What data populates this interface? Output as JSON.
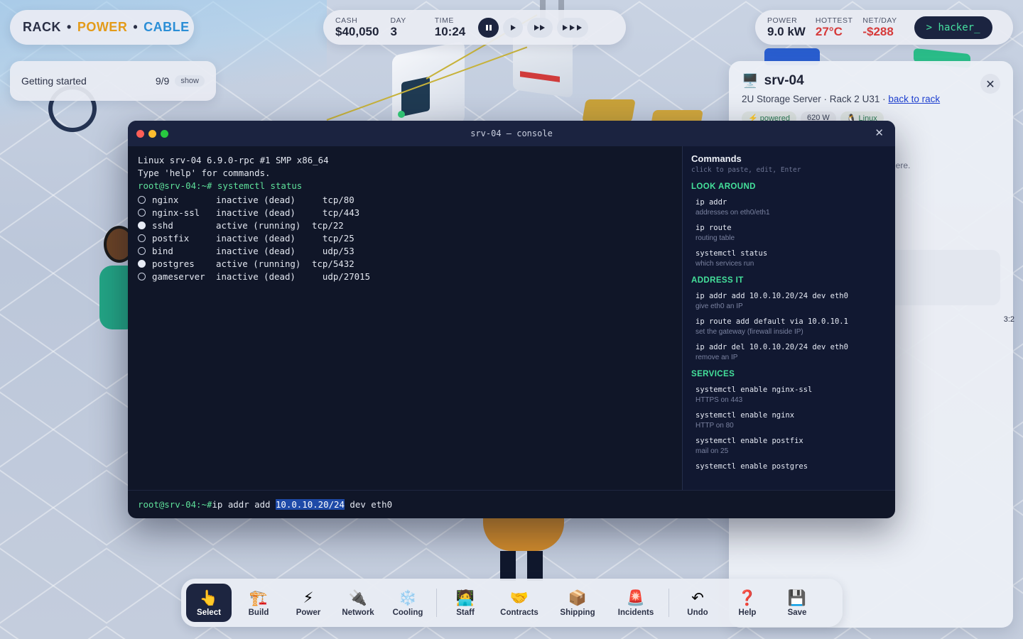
{
  "brand": {
    "rack": "RACK",
    "dot": "•",
    "power": "POWER",
    "cable": "CABLE"
  },
  "getting_started": {
    "title": "Getting started",
    "count": "9/9",
    "show_label": "show"
  },
  "hud": {
    "cash_label": "CASH",
    "cash": "$40,050",
    "day_label": "DAY",
    "day": "3",
    "time_label": "TIME",
    "time": "10:24",
    "power_label": "POWER",
    "power": "9.0 kW",
    "hottest_label": "HOTTEST",
    "hottest": "27°C",
    "net_label": "NET/DAY",
    "net": "-$288",
    "hacker_label": "> hacker_",
    "speed_icons": {
      "pause": "pause-icon",
      "play": "play-icon",
      "fast": "fast-forward-icon",
      "faster": "faster-forward-icon"
    },
    "colors": {
      "hot": "#d63a3a",
      "net": "#d63a3a"
    }
  },
  "inspector": {
    "icon": "🖥️",
    "title": "srv-04",
    "subtitle": "2U Storage Server · Rack 2 U31 · ",
    "back_link": "back to rack",
    "badges": [
      "⚡ powered",
      "620 W",
      "🐧 Linux"
    ],
    "partial_text": "nere.",
    "edge_text": "3:2"
  },
  "console": {
    "title": "srv-04 — console",
    "boot_line1": "Linux srv-04 6.9.0-rpc #1 SMP x86_64",
    "boot_line2": "Type 'help' for commands.",
    "prompt": "root@srv-04:~#",
    "last_command": " systemctl status",
    "services": [
      {
        "name": "nginx",
        "state": "inactive (dead)",
        "port": "  tcp/80",
        "active": false
      },
      {
        "name": "nginx-ssl",
        "state": "inactive (dead)",
        "port": "  tcp/443",
        "active": false
      },
      {
        "name": "sshd",
        "state": "active (running)",
        "port": "tcp/22",
        "active": true
      },
      {
        "name": "postfix",
        "state": "inactive (dead)",
        "port": "  tcp/25",
        "active": false
      },
      {
        "name": "bind",
        "state": "inactive (dead)",
        "port": "  udp/53",
        "active": false
      },
      {
        "name": "postgres",
        "state": "active (running)",
        "port": "tcp/5432",
        "active": true
      },
      {
        "name": "gameserver",
        "state": "inactive (dead)",
        "port": "  udp/27015",
        "active": false
      }
    ],
    "input": {
      "prompt": "root@srv-04:~#",
      "before": "ip addr add ",
      "selected": "10.0.10.20/24",
      "after": " dev eth0"
    }
  },
  "commands": {
    "heading": "Commands",
    "hint": "click to paste, edit, Enter",
    "sections": [
      {
        "title": "LOOK AROUND",
        "items": [
          {
            "cmd": "ip addr",
            "desc": "addresses on eth0/eth1"
          },
          {
            "cmd": "ip route",
            "desc": "routing table"
          },
          {
            "cmd": "systemctl status",
            "desc": "which services run"
          }
        ]
      },
      {
        "title": "ADDRESS IT",
        "items": [
          {
            "cmd": "ip addr add 10.0.10.20/24 dev eth0",
            "desc": "give eth0 an IP"
          },
          {
            "cmd": "ip route add default via 10.0.10.1",
            "desc": "set the gateway (firewall inside IP)"
          },
          {
            "cmd": "ip addr del 10.0.10.20/24 dev eth0",
            "desc": "remove an IP"
          }
        ]
      },
      {
        "title": "SERVICES",
        "items": [
          {
            "cmd": "systemctl enable nginx-ssl",
            "desc": "HTTPS on 443"
          },
          {
            "cmd": "systemctl enable nginx",
            "desc": "HTTP on 80"
          },
          {
            "cmd": "systemctl enable postfix",
            "desc": "mail on 25"
          },
          {
            "cmd": "systemctl enable postgres",
            "desc": ""
          }
        ]
      }
    ]
  },
  "toolbar": {
    "tools": [
      {
        "icon": "👆",
        "label": "Select"
      },
      {
        "icon": "🏗️",
        "label": "Build"
      },
      {
        "icon": "⚡",
        "label": "Power"
      },
      {
        "icon": "🔌",
        "label": "Network"
      },
      {
        "icon": "❄️",
        "label": "Cooling"
      },
      {
        "icon": "🧑‍💻",
        "label": "Staff"
      },
      {
        "icon": "🤝",
        "label": "Contracts"
      },
      {
        "icon": "📦",
        "label": "Shipping"
      },
      {
        "icon": "🚨",
        "label": "Incidents"
      },
      {
        "icon": "↶",
        "label": "Undo"
      },
      {
        "icon": "❓",
        "label": "Help"
      },
      {
        "icon": "💾",
        "label": "Save"
      }
    ],
    "active": "Select"
  }
}
